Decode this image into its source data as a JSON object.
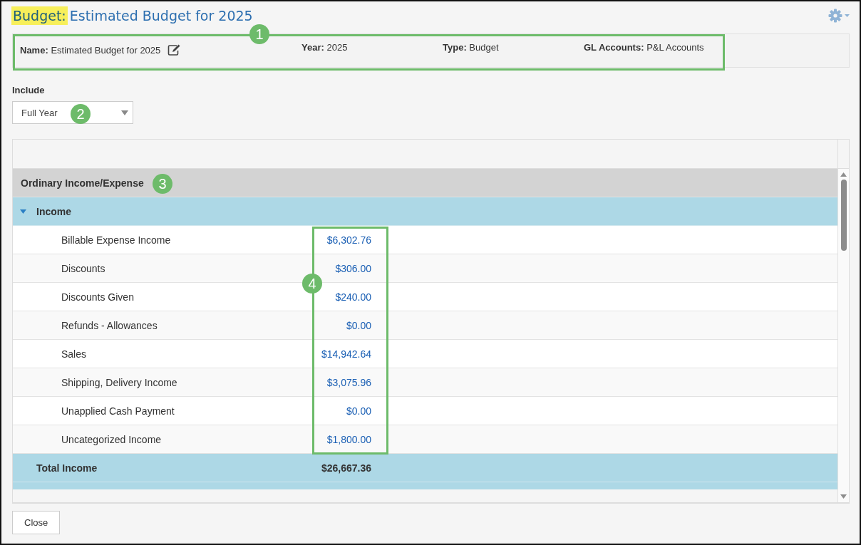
{
  "title": {
    "prefix": "Budget:",
    "name": "Estimated Budget for 2025"
  },
  "info": [
    {
      "label": "Name:",
      "value": "Estimated Budget for 2025",
      "editable": true
    },
    {
      "label": "Year:",
      "value": "2025",
      "editable": false
    },
    {
      "label": "Type:",
      "value": "Budget",
      "editable": false
    },
    {
      "label": "GL Accounts:",
      "value": "P&L Accounts",
      "editable": false
    }
  ],
  "include": {
    "label": "Include",
    "value": "Full Year"
  },
  "rows": [
    {
      "kind": "section",
      "label": "Ordinary Income/Expense"
    },
    {
      "kind": "group",
      "label": "Income",
      "expanded": true
    },
    {
      "kind": "item",
      "label": "Billable Expense Income",
      "value": "$6,302.76"
    },
    {
      "kind": "item",
      "label": "Discounts",
      "value": "$306.00"
    },
    {
      "kind": "item",
      "label": "Discounts Given",
      "value": "$240.00"
    },
    {
      "kind": "item",
      "label": "Refunds - Allowances",
      "value": "$0.00"
    },
    {
      "kind": "item",
      "label": "Sales",
      "value": "$14,942.64"
    },
    {
      "kind": "item",
      "label": "Shipping, Delivery Income",
      "value": "$3,075.96"
    },
    {
      "kind": "item",
      "label": "Unapplied Cash Payment",
      "value": "$0.00"
    },
    {
      "kind": "item",
      "label": "Uncategorized Income",
      "value": "$1,800.00"
    },
    {
      "kind": "total",
      "label": "Total Income",
      "value": "$26,667.36"
    },
    {
      "kind": "cut"
    }
  ],
  "buttons": [
    "Close"
  ],
  "callouts": [
    "1",
    "2",
    "3",
    "4"
  ]
}
